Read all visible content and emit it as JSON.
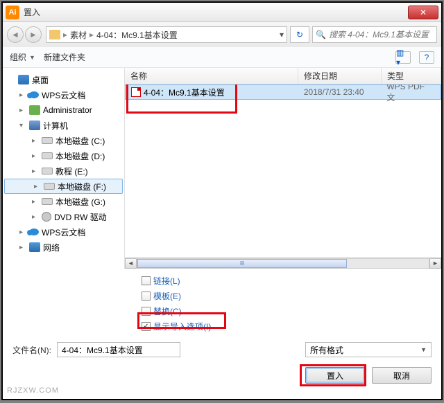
{
  "title": "置入",
  "app_icon_text": "Ai",
  "breadcrumb": {
    "part1": "素材",
    "part2": "4-04：Mc9.1基本设置"
  },
  "search": {
    "placeholder": "搜索 4-04：Mc9.1基本设置"
  },
  "toolbar": {
    "organize": "组织",
    "new_folder": "新建文件夹"
  },
  "columns": {
    "name": "名称",
    "modified": "修改日期",
    "type": "类型"
  },
  "tree": {
    "desktop": "桌面",
    "wps": "WPS云文档",
    "admin": "Administrator",
    "computer": "计算机",
    "disk_c": "本地磁盘 (C:)",
    "disk_d": "本地磁盘 (D:)",
    "disk_e": "教程 (E:)",
    "disk_f": "本地磁盘 (F:)",
    "disk_g": "本地磁盘 (G:)",
    "dvd": "DVD RW 驱动",
    "wps2": "WPS云文档",
    "network": "网络"
  },
  "file": {
    "name": "4-04：Mc9.1基本设置",
    "modified": "2018/7/31 23:40",
    "type": "WPS PDF 文"
  },
  "options": {
    "link": "链接(L)",
    "template": "模板(E)",
    "replace": "替换(C)",
    "show_import": "显示导入选项(I)"
  },
  "filename_label": "文件名(N):",
  "filename_value": "4-04：Mc9.1基本设置",
  "filter": "所有格式",
  "buttons": {
    "place": "置入",
    "cancel": "取消"
  },
  "watermark": "RJZXW.COM"
}
